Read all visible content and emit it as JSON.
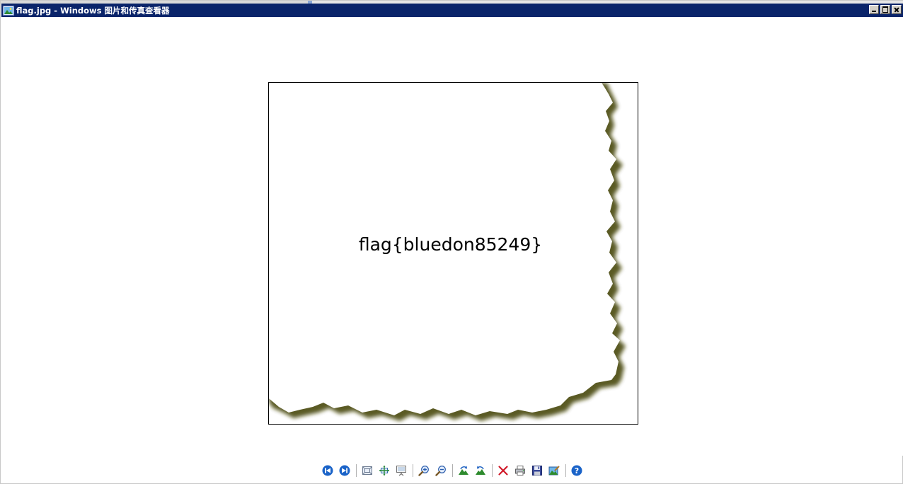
{
  "window": {
    "title": "flag.jpg - Windows 图片和传真查看器",
    "controls": [
      "minimize",
      "maximize",
      "close"
    ],
    "titlebar_color": "#0a246a"
  },
  "image": {
    "text": "flag{bluedon85249}",
    "effect": "torn-paper edge with shadow",
    "shadow_color": "#4a4a10"
  },
  "toolbar": {
    "buttons": [
      {
        "name": "previous-image",
        "icon": "previous-icon"
      },
      {
        "name": "next-image",
        "icon": "next-icon"
      },
      {
        "name": "best-fit",
        "icon": "best-fit-icon"
      },
      {
        "name": "actual-size",
        "icon": "actual-size-icon"
      },
      {
        "name": "slideshow",
        "icon": "slideshow-icon"
      },
      {
        "name": "zoom-in",
        "icon": "zoom-in-icon"
      },
      {
        "name": "zoom-out",
        "icon": "zoom-out-icon"
      },
      {
        "name": "rotate-clockwise",
        "icon": "rotate-clockwise-icon"
      },
      {
        "name": "rotate-counterclockwise",
        "icon": "rotate-counterclockwise-icon"
      },
      {
        "name": "delete",
        "icon": "delete-icon"
      },
      {
        "name": "print",
        "icon": "print-icon"
      },
      {
        "name": "copy-to",
        "icon": "save-icon"
      },
      {
        "name": "open-for-editing",
        "icon": "edit-image-icon"
      },
      {
        "name": "help",
        "icon": "help-icon"
      }
    ]
  }
}
